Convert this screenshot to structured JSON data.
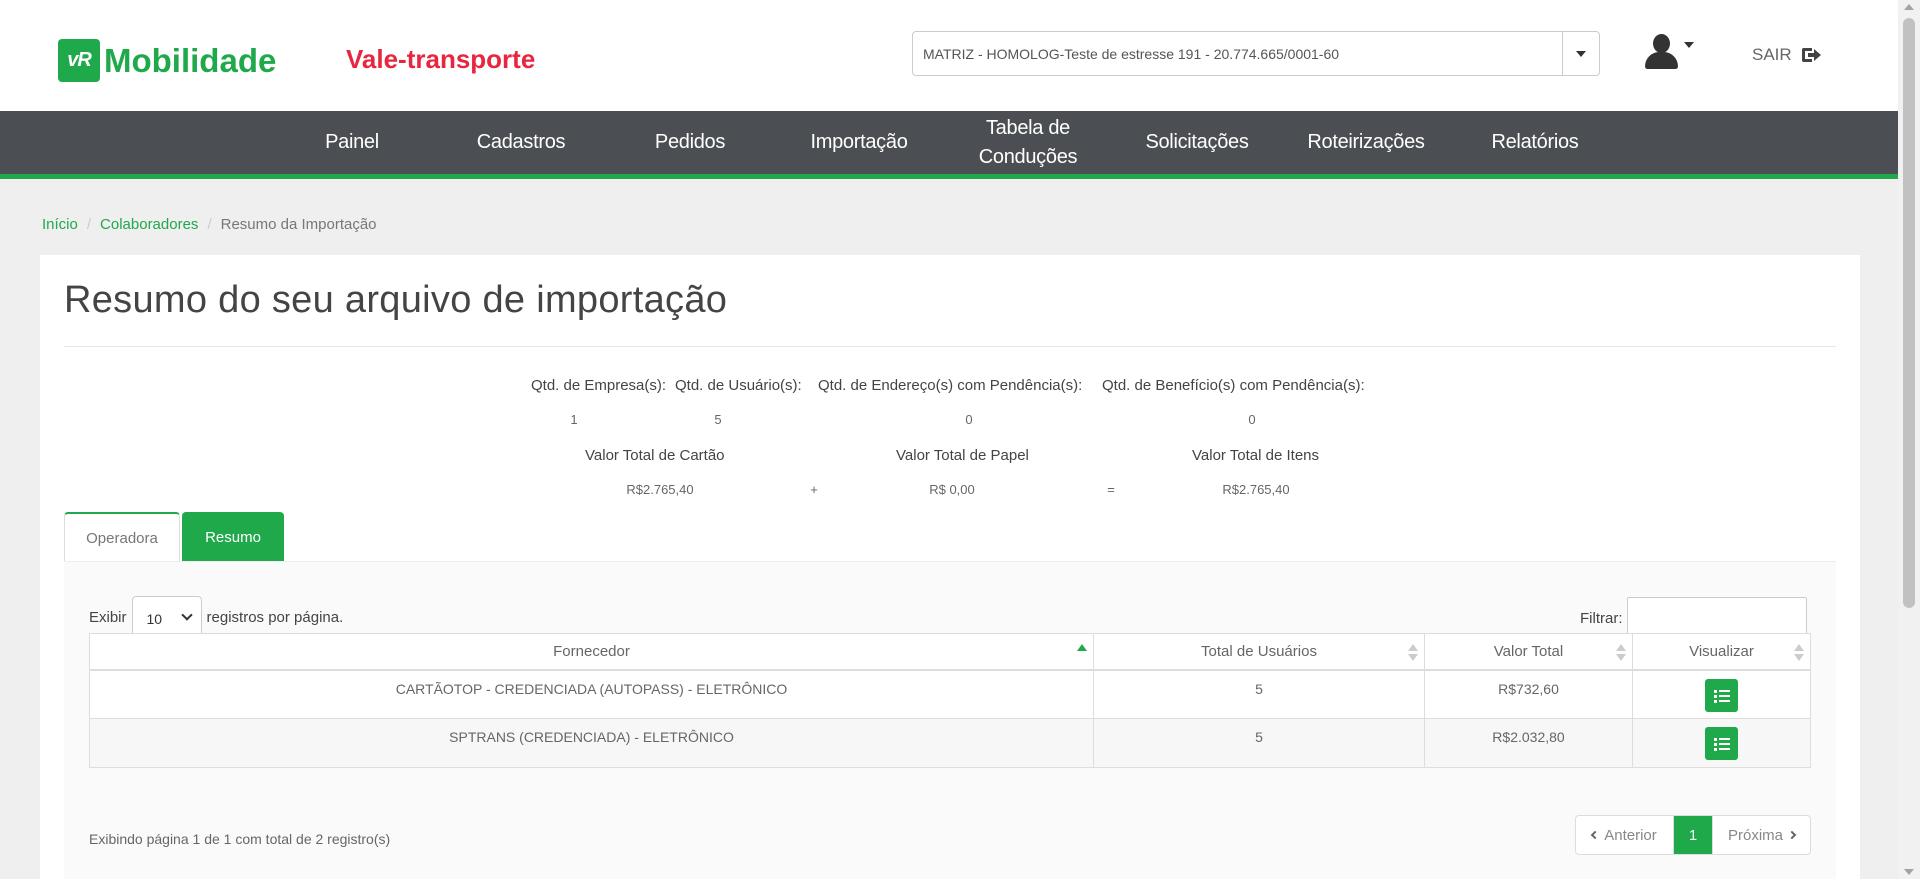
{
  "brand": {
    "logo_mark": "vR",
    "logo_text": "Mobilidade",
    "product": "Vale-transporte",
    "brand_color": "#1fa94a",
    "product_color": "#e8263f"
  },
  "header": {
    "company_select": "MATRIZ - HOMOLOG-Teste de estresse 191 - 20.774.665/0001-60",
    "logout_label": "SAIR"
  },
  "nav": {
    "items": [
      {
        "label": "Painel"
      },
      {
        "label": "Cadastros"
      },
      {
        "label": "Pedidos"
      },
      {
        "label": "Importação"
      },
      {
        "label": "Tabela de\nConduções"
      },
      {
        "label": "Solicitações"
      },
      {
        "label": "Roteirizações"
      },
      {
        "label": "Relatórios"
      }
    ]
  },
  "breadcrumb": {
    "home": "Início",
    "parent": "Colaboradores",
    "current": "Resumo da Importação"
  },
  "page": {
    "title": "Resumo do seu arquivo de importação"
  },
  "summary": {
    "qtd_empresas_label": "Qtd. de Empresa(s):",
    "qtd_empresas": "1",
    "qtd_usuarios_label": "Qtd. de Usuário(s):",
    "qtd_usuarios": "5",
    "qtd_endereco_label": "Qtd. de Endereço(s) com Pendência(s):",
    "qtd_endereco": "0",
    "qtd_beneficio_label": "Qtd. de Benefício(s) com Pendência(s):",
    "qtd_beneficio": "0",
    "valor_cartao_label": "Valor Total de Cartão",
    "valor_cartao": "R$2.765,40",
    "plus": "+",
    "valor_papel_label": "Valor Total de Papel",
    "valor_papel": "R$ 0,00",
    "equals": "=",
    "valor_itens_label": "Valor Total de Itens",
    "valor_itens": "R$2.765,40"
  },
  "tabs": {
    "operadora": "Operadora",
    "resumo": "Resumo"
  },
  "table_controls": {
    "show_prefix": "Exibir",
    "page_size": "10",
    "show_suffix": "registros por página.",
    "filter_label": "Filtrar:"
  },
  "table": {
    "headers": [
      "Fornecedor",
      "Total de Usuários",
      "Valor Total",
      "Visualizar"
    ],
    "rows": [
      {
        "fornecedor": "CARTÃOTOP - CREDENCIADA (AUTOPASS) - ELETRÔNICO",
        "usuarios": "5",
        "valor": "R$732,60"
      },
      {
        "fornecedor": "SPTRANS (CREDENCIADA) - ELETRÔNICO",
        "usuarios": "5",
        "valor": "R$2.032,80"
      }
    ]
  },
  "pagination": {
    "info": "Exibindo página 1 de 1 com total de 2 registro(s)",
    "prev": "Anterior",
    "current": "1",
    "next": "Próxima"
  }
}
